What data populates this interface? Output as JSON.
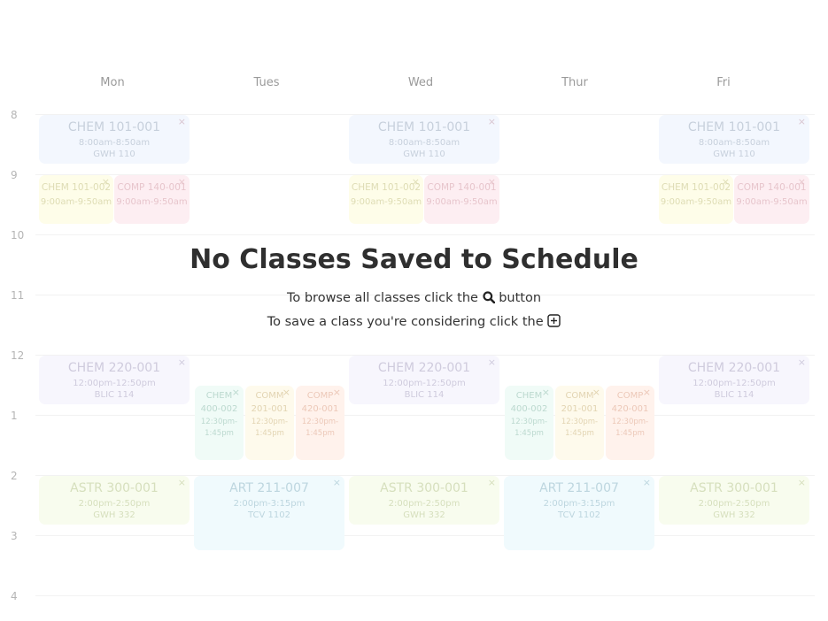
{
  "days": [
    "Mon",
    "Tues",
    "Wed",
    "Thur",
    "Fri"
  ],
  "hours": [
    "8",
    "9",
    "10",
    "11",
    "12",
    "1",
    "2",
    "3",
    "4"
  ],
  "empty_state": {
    "title": "No Classes Saved to Schedule",
    "browse_prefix": "To browse all classes click the",
    "browse_suffix": "button",
    "save_prefix": "To save a class you're considering click the"
  },
  "icons": {
    "close": "×",
    "search": "search-icon",
    "add": "plus-square-icon"
  },
  "classes": {
    "chem101_001": {
      "name": "CHEM 101-001",
      "time": "8:00am-8:50am",
      "room": "GWH 110",
      "color": "#f3f7fe"
    },
    "chem101_002": {
      "name": "CHEM 101-002",
      "time": "9:00am-9:50am",
      "color": "#fefde9"
    },
    "comp140_001": {
      "name": "COMP 140-001",
      "time": "9:00am-9:50am",
      "color": "#fdeef2"
    },
    "chem220_001": {
      "name": "CHEM 220-001",
      "time": "12:00pm-12:50pm",
      "room": "BLIC 114",
      "color": "#f7f6fd"
    },
    "chem400_002": {
      "name": "CHEM 400-002",
      "time": "12:30pm-1:45pm",
      "color": "#f0fbf7"
    },
    "comm201_001": {
      "name": "COMM 201-001",
      "time": "12:30pm-1:45pm",
      "color": "#fefaec"
    },
    "comp420_001": {
      "name": "COMP 420-001",
      "time": "12:30pm-1:45pm",
      "color": "#fff2ec"
    },
    "astr300_001": {
      "name": "ASTR 300-001",
      "time": "2:00pm-2:50pm",
      "room": "GWH 332",
      "color": "#f8fcee"
    },
    "art211_007": {
      "name": "ART 211-007",
      "time": "2:00pm-3:15pm",
      "room": "TCV 1102",
      "color": "#f0fafd"
    }
  }
}
